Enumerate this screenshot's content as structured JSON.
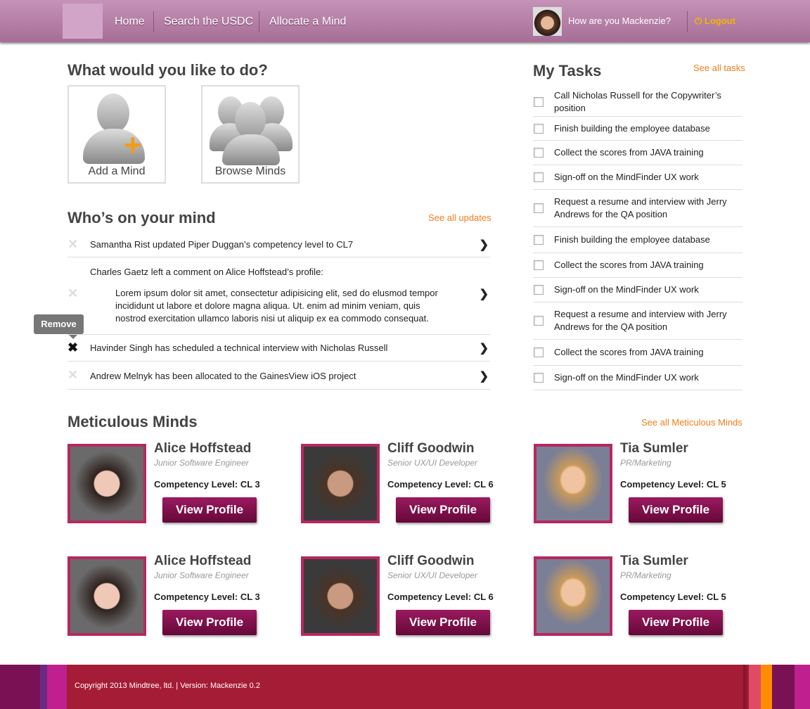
{
  "header": {
    "nav": [
      "Home",
      "Search the USDC",
      "Allocate a Mind"
    ],
    "greeting": "How are you Mackenzie?",
    "logout": "Logout"
  },
  "actions": {
    "title": "What would you like to do?",
    "add": "Add a Mind",
    "browse": "Browse Minds"
  },
  "updates": {
    "title": "Who’s on your mind",
    "see_all": "See all updates",
    "tooltip": "Remove",
    "items": [
      "Samantha Rist updated Piper Duggan’s competency level to CL7",
      "Charles Gaetz left a comment on Alice Hoffstead’s profile:",
      "Havinder Singh has scheduled a technical interview with Nicholas Russell",
      "Andrew Melnyk has been allocated to the GainesView iOS project"
    ],
    "comment": "Lorem ipsum dolor sit amet, consectetur adipisicing elit, sed do elusmod tempor incididunt ut labore et dolore magna aliqua. Ut. enim ad minim veniam, quis nostrod exercitation ullamco laboris nisi ut aliquip ex ea commodo consequat."
  },
  "tasks": {
    "title": "My Tasks",
    "see_all": "See all tasks",
    "items": [
      "Call Nicholas Russell for the Copywriter’s position",
      "Finish building the employee database",
      "Collect the scores from JAVA training",
      "Sign-off on the MindFinder UX work",
      "Request a resume and interview with Jerry Andrews for the QA position",
      "Finish building the employee database",
      "Collect the scores from JAVA training",
      "Sign-off on the MindFinder UX work",
      "Request a resume and interview with Jerry Andrews for the QA position",
      "Collect the scores from JAVA training",
      "Sign-off on the MindFinder UX work"
    ]
  },
  "minds": {
    "title": "Meticulous Minds",
    "see_all": "See all Meticulous Minds",
    "button": "View Profile",
    "people": [
      {
        "name": "Alice Hoffstead",
        "role": "Junior Software Engineer",
        "level": "Competency Level:  CL 3"
      },
      {
        "name": "Cliff Goodwin",
        "role": "Senior UX/UI Developer",
        "level": "Competency Level:  CL 6"
      },
      {
        "name": "Tia Sumler",
        "role": "PR/Marketing",
        "level": "Competency Level:  CL 5"
      },
      {
        "name": "Alice Hoffstead",
        "role": "Junior Software Engineer",
        "level": "Competency Level:  CL 3"
      },
      {
        "name": "Cliff Goodwin",
        "role": "Senior UX/UI Developer",
        "level": "Competency Level:  CL 6"
      },
      {
        "name": "Tia Sumler",
        "role": "PR/Marketing",
        "level": "Competency Level:  CL 5"
      }
    ]
  },
  "footer": {
    "copyright": "Copyright 2013 Mindtree, ltd. | Version: Mackenzie 0.2"
  }
}
